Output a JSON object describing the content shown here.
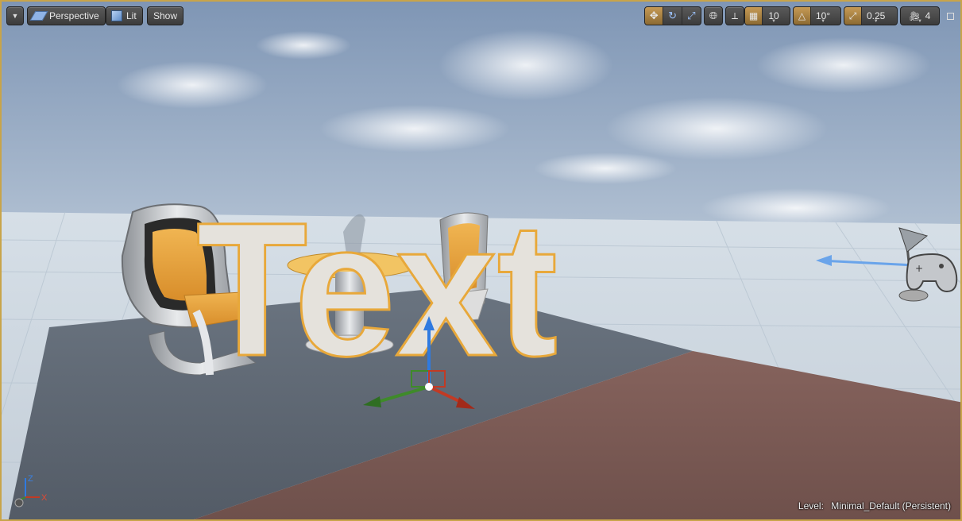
{
  "toolbar": {
    "menu_icon": "chevron-down-icon",
    "view_mode": "Perspective",
    "lighting_mode": "Lit",
    "show_label": "Show",
    "grid_snap_value": "10",
    "rotation_snap_value": "10°",
    "scale_snap_value": "0.25",
    "camera_speed_value": "4"
  },
  "scene": {
    "text_actor": "Text",
    "axes": {
      "z": "Z",
      "x": "X"
    }
  },
  "status": {
    "level_key": "Level:",
    "level_value": "Minimal_Default (Persistent)"
  },
  "colors": {
    "selection": "#e8a83a",
    "toolbar_active": "#b3894a",
    "sky_top": "#7f96b5",
    "floor_gray": "#5e6773",
    "floor_brown": "#7a5a55"
  }
}
